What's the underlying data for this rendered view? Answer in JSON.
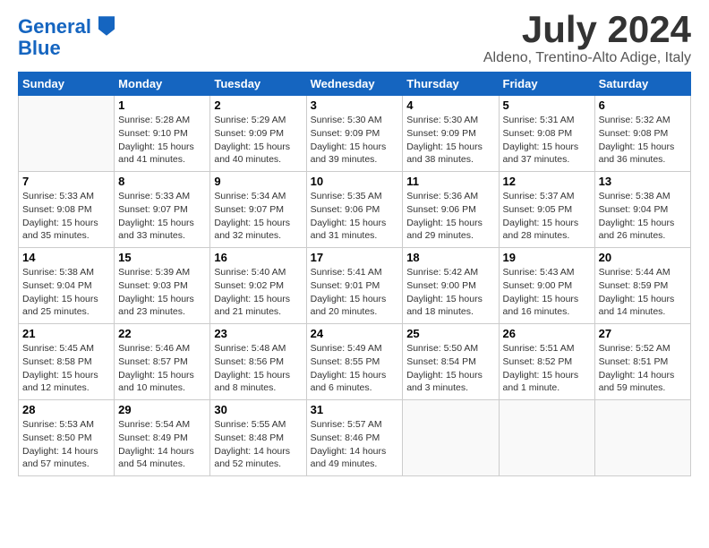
{
  "header": {
    "logo_line1": "General",
    "logo_line2": "Blue",
    "month": "July 2024",
    "location": "Aldeno, Trentino-Alto Adige, Italy"
  },
  "weekdays": [
    "Sunday",
    "Monday",
    "Tuesday",
    "Wednesday",
    "Thursday",
    "Friday",
    "Saturday"
  ],
  "weeks": [
    [
      {
        "day": "",
        "info": ""
      },
      {
        "day": "1",
        "info": "Sunrise: 5:28 AM\nSunset: 9:10 PM\nDaylight: 15 hours\nand 41 minutes."
      },
      {
        "day": "2",
        "info": "Sunrise: 5:29 AM\nSunset: 9:09 PM\nDaylight: 15 hours\nand 40 minutes."
      },
      {
        "day": "3",
        "info": "Sunrise: 5:30 AM\nSunset: 9:09 PM\nDaylight: 15 hours\nand 39 minutes."
      },
      {
        "day": "4",
        "info": "Sunrise: 5:30 AM\nSunset: 9:09 PM\nDaylight: 15 hours\nand 38 minutes."
      },
      {
        "day": "5",
        "info": "Sunrise: 5:31 AM\nSunset: 9:08 PM\nDaylight: 15 hours\nand 37 minutes."
      },
      {
        "day": "6",
        "info": "Sunrise: 5:32 AM\nSunset: 9:08 PM\nDaylight: 15 hours\nand 36 minutes."
      }
    ],
    [
      {
        "day": "7",
        "info": "Sunrise: 5:33 AM\nSunset: 9:08 PM\nDaylight: 15 hours\nand 35 minutes."
      },
      {
        "day": "8",
        "info": "Sunrise: 5:33 AM\nSunset: 9:07 PM\nDaylight: 15 hours\nand 33 minutes."
      },
      {
        "day": "9",
        "info": "Sunrise: 5:34 AM\nSunset: 9:07 PM\nDaylight: 15 hours\nand 32 minutes."
      },
      {
        "day": "10",
        "info": "Sunrise: 5:35 AM\nSunset: 9:06 PM\nDaylight: 15 hours\nand 31 minutes."
      },
      {
        "day": "11",
        "info": "Sunrise: 5:36 AM\nSunset: 9:06 PM\nDaylight: 15 hours\nand 29 minutes."
      },
      {
        "day": "12",
        "info": "Sunrise: 5:37 AM\nSunset: 9:05 PM\nDaylight: 15 hours\nand 28 minutes."
      },
      {
        "day": "13",
        "info": "Sunrise: 5:38 AM\nSunset: 9:04 PM\nDaylight: 15 hours\nand 26 minutes."
      }
    ],
    [
      {
        "day": "14",
        "info": "Sunrise: 5:38 AM\nSunset: 9:04 PM\nDaylight: 15 hours\nand 25 minutes."
      },
      {
        "day": "15",
        "info": "Sunrise: 5:39 AM\nSunset: 9:03 PM\nDaylight: 15 hours\nand 23 minutes."
      },
      {
        "day": "16",
        "info": "Sunrise: 5:40 AM\nSunset: 9:02 PM\nDaylight: 15 hours\nand 21 minutes."
      },
      {
        "day": "17",
        "info": "Sunrise: 5:41 AM\nSunset: 9:01 PM\nDaylight: 15 hours\nand 20 minutes."
      },
      {
        "day": "18",
        "info": "Sunrise: 5:42 AM\nSunset: 9:00 PM\nDaylight: 15 hours\nand 18 minutes."
      },
      {
        "day": "19",
        "info": "Sunrise: 5:43 AM\nSunset: 9:00 PM\nDaylight: 15 hours\nand 16 minutes."
      },
      {
        "day": "20",
        "info": "Sunrise: 5:44 AM\nSunset: 8:59 PM\nDaylight: 15 hours\nand 14 minutes."
      }
    ],
    [
      {
        "day": "21",
        "info": "Sunrise: 5:45 AM\nSunset: 8:58 PM\nDaylight: 15 hours\nand 12 minutes."
      },
      {
        "day": "22",
        "info": "Sunrise: 5:46 AM\nSunset: 8:57 PM\nDaylight: 15 hours\nand 10 minutes."
      },
      {
        "day": "23",
        "info": "Sunrise: 5:48 AM\nSunset: 8:56 PM\nDaylight: 15 hours\nand 8 minutes."
      },
      {
        "day": "24",
        "info": "Sunrise: 5:49 AM\nSunset: 8:55 PM\nDaylight: 15 hours\nand 6 minutes."
      },
      {
        "day": "25",
        "info": "Sunrise: 5:50 AM\nSunset: 8:54 PM\nDaylight: 15 hours\nand 3 minutes."
      },
      {
        "day": "26",
        "info": "Sunrise: 5:51 AM\nSunset: 8:52 PM\nDaylight: 15 hours\nand 1 minute."
      },
      {
        "day": "27",
        "info": "Sunrise: 5:52 AM\nSunset: 8:51 PM\nDaylight: 14 hours\nand 59 minutes."
      }
    ],
    [
      {
        "day": "28",
        "info": "Sunrise: 5:53 AM\nSunset: 8:50 PM\nDaylight: 14 hours\nand 57 minutes."
      },
      {
        "day": "29",
        "info": "Sunrise: 5:54 AM\nSunset: 8:49 PM\nDaylight: 14 hours\nand 54 minutes."
      },
      {
        "day": "30",
        "info": "Sunrise: 5:55 AM\nSunset: 8:48 PM\nDaylight: 14 hours\nand 52 minutes."
      },
      {
        "day": "31",
        "info": "Sunrise: 5:57 AM\nSunset: 8:46 PM\nDaylight: 14 hours\nand 49 minutes."
      },
      {
        "day": "",
        "info": ""
      },
      {
        "day": "",
        "info": ""
      },
      {
        "day": "",
        "info": ""
      }
    ]
  ]
}
